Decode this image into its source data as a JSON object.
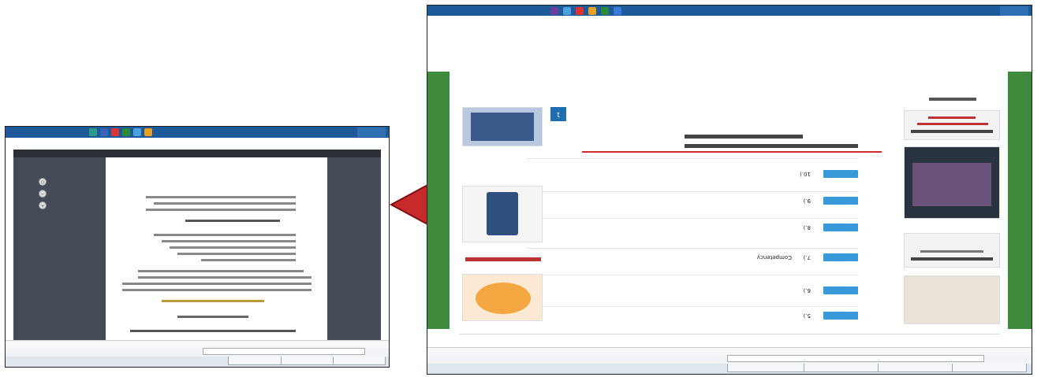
{
  "left_shot": {
    "viewer_title": "",
    "tabs": [
      "",
      "",
      ""
    ],
    "slide_lines": [
      "",
      "",
      "",
      "",
      "",
      "",
      "",
      "",
      "",
      ""
    ],
    "controls": [
      "+",
      "−",
      "○"
    ]
  },
  "right_shot": {
    "site_nav": [
      "",
      "",
      "",
      "",
      "",
      ""
    ],
    "section_heading": "",
    "courses": [
      {
        "num": "5.)",
        "button": ""
      },
      {
        "num": "6.)",
        "button": ""
      },
      {
        "num": "7.)",
        "button": "",
        "suffix": "Competency"
      },
      {
        "num": "8.)",
        "button": ""
      },
      {
        "num": "9.)",
        "button": ""
      },
      {
        "num": "10.)",
        "button": ""
      }
    ],
    "pager": "1"
  },
  "colors": {
    "arrow_fill": "#c8292b",
    "arrow_stroke": "#7a1010",
    "site_green": "#3d8a3d",
    "course_button": "#3a9ad9",
    "taskbar": "#1e5a9a"
  },
  "icons": [
    "arrow-left-icon",
    "windows-start-icon",
    "browser-icon"
  ]
}
